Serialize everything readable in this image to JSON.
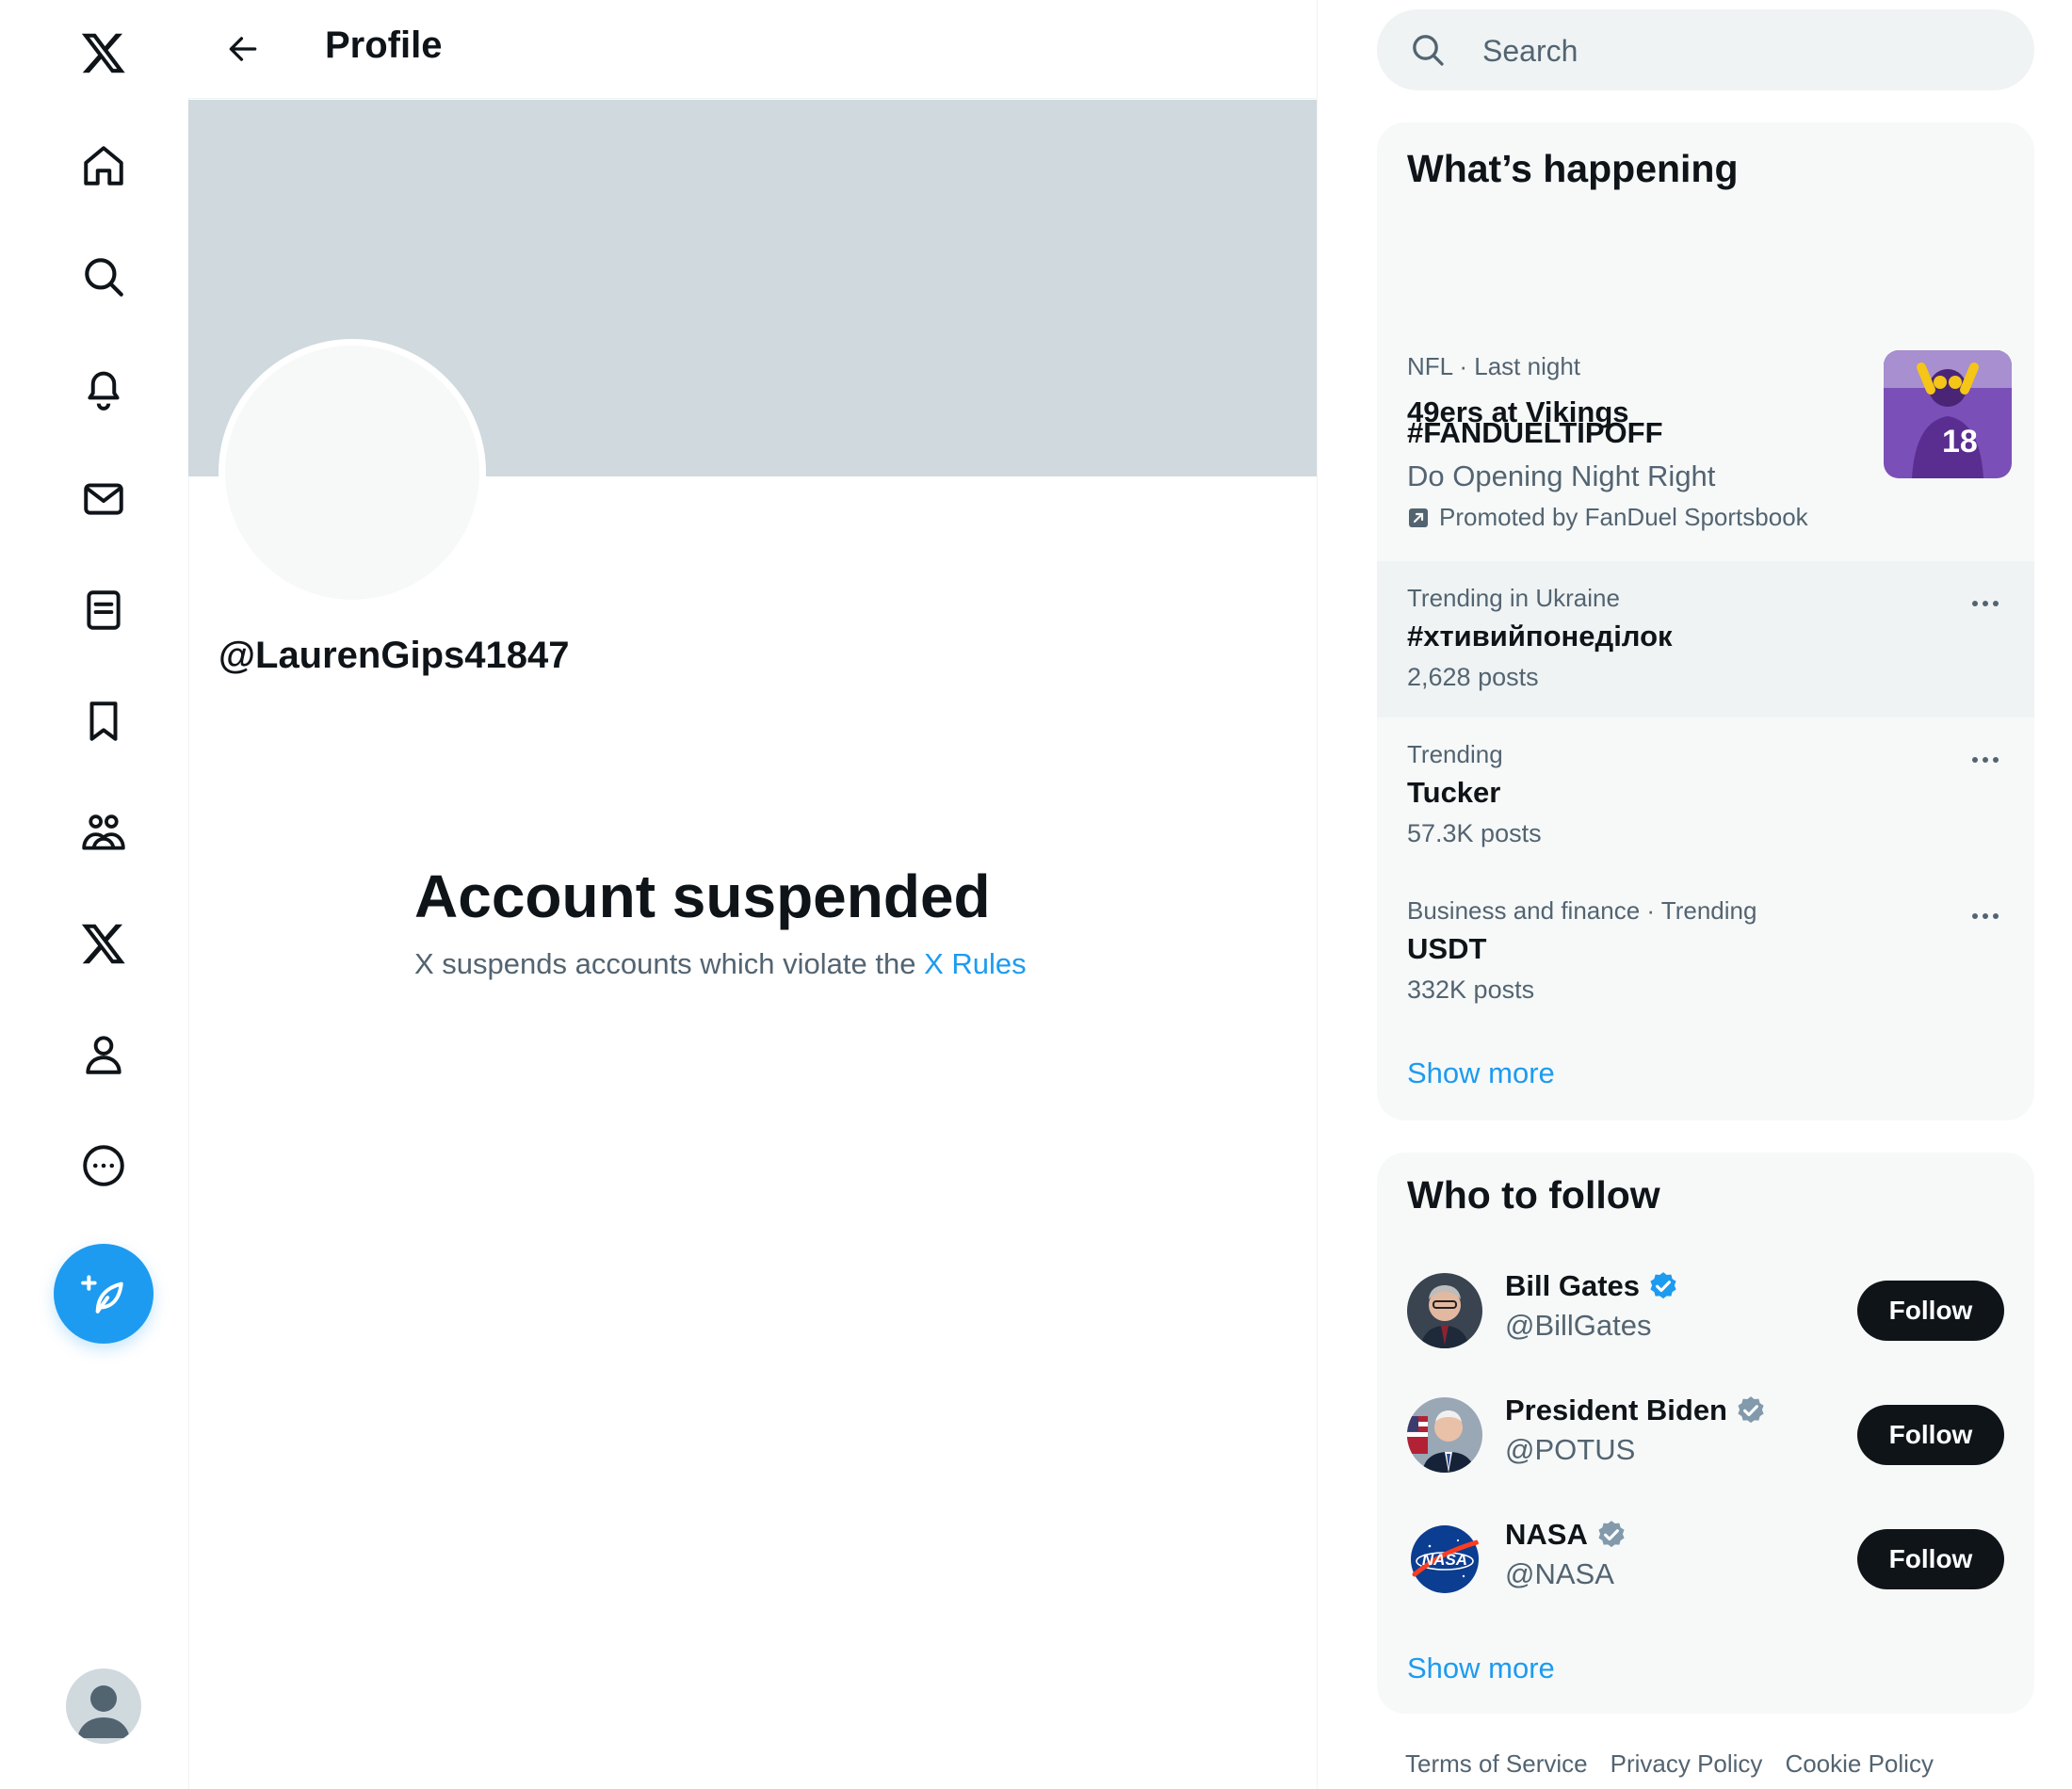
{
  "header": {
    "title": "Profile"
  },
  "profile": {
    "handle": "@LaurenGips41847",
    "suspended_title": "Account suspended",
    "suspended_text": "X suspends accounts which violate the ",
    "rules_link": "X Rules"
  },
  "search": {
    "placeholder": "Search"
  },
  "happening": {
    "title": "What’s happening",
    "trends": [
      {
        "meta": "NFL · Last night",
        "name": "49ers at Vikings"
      },
      {
        "name": "#FANDUELTIPOFF",
        "sub": "Do Opening Night Right",
        "promo": "Promoted by FanDuel Sportsbook"
      },
      {
        "meta": "Trending in Ukraine",
        "name": "#хтивийпонеділок",
        "sub": "2,628 posts"
      },
      {
        "meta": "Trending",
        "name": "Tucker",
        "sub": "57.3K posts"
      },
      {
        "meta": "Business and finance · Trending",
        "name": "USDT",
        "sub": "332K posts"
      }
    ],
    "show_more": "Show more"
  },
  "who_to_follow": {
    "title": "Who to follow",
    "users": [
      {
        "name": "Bill Gates",
        "handle": "@BillGates",
        "button": "Follow"
      },
      {
        "name": "President Biden",
        "handle": "@POTUS",
        "button": "Follow"
      },
      {
        "name": "NASA",
        "handle": "@NASA",
        "button": "Follow"
      }
    ],
    "show_more": "Show more"
  },
  "footer": {
    "links": [
      "Terms of Service",
      "Privacy Policy",
      "Cookie Policy"
    ]
  },
  "colors": {
    "accent": "#1d9bf0",
    "banner": "#cfd9de",
    "panel": "#f7f9f9",
    "text": "#0f1419",
    "muted": "#536471"
  },
  "icons": [
    "x-logo-icon",
    "home-icon",
    "explore-icon",
    "notifications-icon",
    "messages-icon",
    "lists-icon",
    "bookmarks-icon",
    "communities-icon",
    "premium-icon",
    "profile-icon",
    "more-icon",
    "compose-icon",
    "search-icon",
    "more-dots-icon",
    "verified-badge-icon"
  ]
}
